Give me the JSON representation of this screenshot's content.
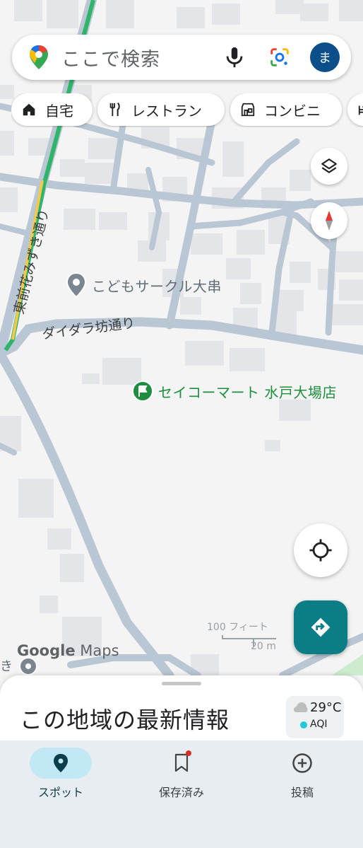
{
  "search": {
    "placeholder": "ここで検索",
    "avatar_initial": "ま"
  },
  "chips": [
    {
      "label": "自宅",
      "icon": "home-icon"
    },
    {
      "label": "レストラン",
      "icon": "restaurant-icon"
    },
    {
      "label": "コンビニ",
      "icon": "convenience-store-icon"
    }
  ],
  "map": {
    "places": [
      {
        "name": "こどもサークル大串",
        "icon": "place-pin-icon"
      },
      {
        "name": "セイコーマート 水戸大場店",
        "icon": "store-flag-icon",
        "color": "#1e8e3e"
      }
    ],
    "streets": {
      "vertical": "東前花みずき通り",
      "horizontal": "ダイダラ坊通り"
    },
    "edge_label": "き",
    "scale": {
      "feet": "100 フィート",
      "meters": "20 m"
    },
    "watermark": {
      "brand": "Google",
      "product": "Maps"
    }
  },
  "colors": {
    "accent": "#0a7d86",
    "road": "#b9c6d3",
    "highway": "#2fb56a",
    "secondary_road": "#f2c94c"
  },
  "sheet": {
    "title": "この地域の最新情報"
  },
  "weather": {
    "temperature": "29°C",
    "aqi_label": "AQI"
  },
  "nav": [
    {
      "label": "スポット",
      "icon": "explore-pin-icon",
      "active": true
    },
    {
      "label": "保存済み",
      "icon": "bookmark-icon",
      "badge": true
    },
    {
      "label": "投稿",
      "icon": "add-circle-icon"
    }
  ]
}
